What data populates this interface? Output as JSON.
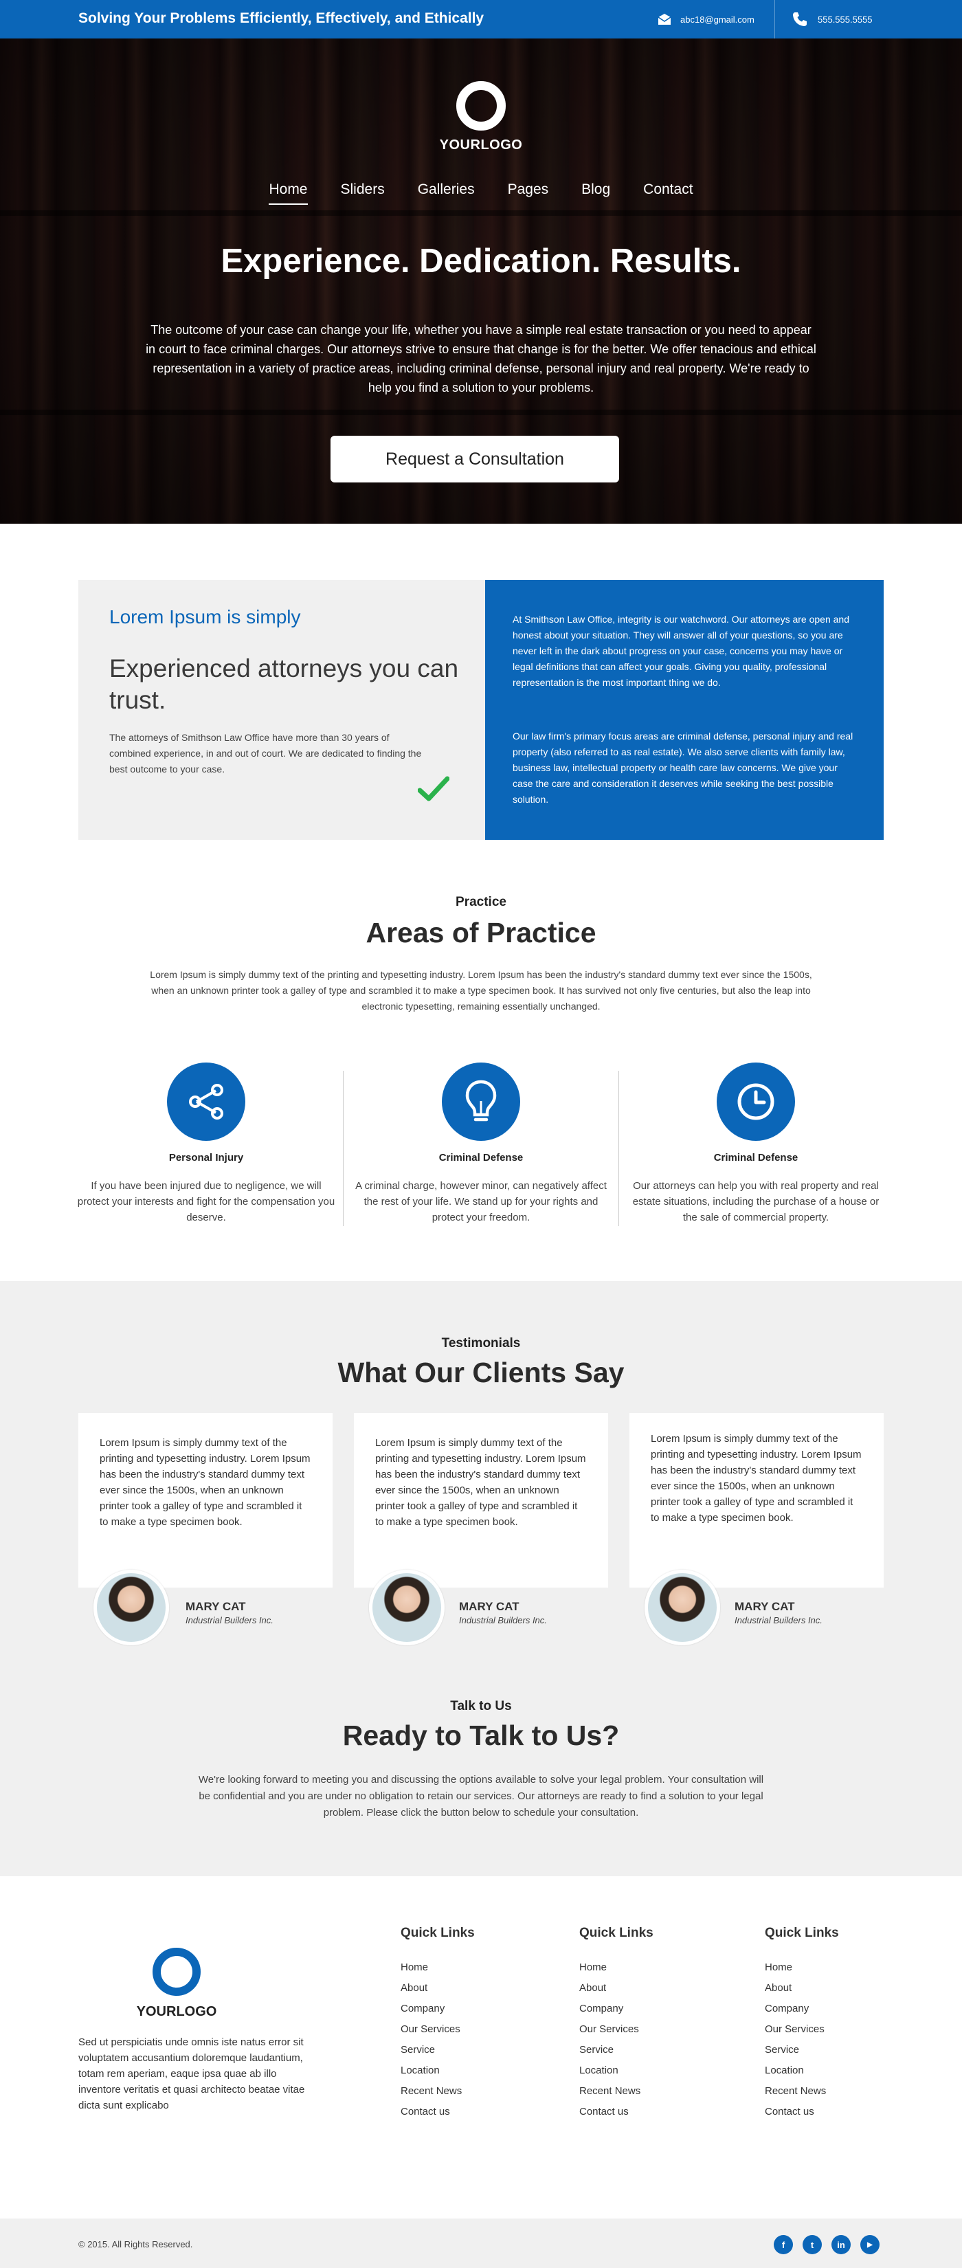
{
  "topbar": {
    "tagline": "Solving Your Problems Efficiently, Effectively, and Ethically",
    "email": "abc18@gmail.com",
    "phone": "555.555.5555",
    "email_icon": "envelope-icon",
    "phone_icon": "phone-icon"
  },
  "hero": {
    "logo_text": "YOURLOGO",
    "nav": [
      "Home",
      "Sliders",
      "Galleries",
      "Pages",
      "Blog",
      "Contact"
    ],
    "active_nav": "Home",
    "headline": "Experience. Dedication. Results.",
    "intro": "The outcome of your case can change your life, whether you have a simple real estate transaction or you need to appear in court to face criminal charges. Our attorneys strive to ensure that change is for the better. We offer tenacious and ethical representation in a variety of practice areas, including criminal defense, personal injury and real property. We're ready to help you find a solution to your problems.",
    "cta": "Request a Consultation"
  },
  "about": {
    "kicker": "Lorem Ipsum is simply",
    "heading": "Experienced attorneys you can trust.",
    "description": "The attorneys of Smithson Law Office have more than 30 years of combined experience, in and out of court. We are dedicated to finding the best outcome to your case.",
    "paragraph1": "At Smithson Law Office, integrity is our watchword. Our attorneys are open and honest about your situation. They will answer all of your questions, so you are never left in the dark about progress on your case, concerns you may have or legal definitions that can affect your goals. Giving you quality, professional representation is the most important thing we do.",
    "paragraph2": "Our law firm's primary focus areas are criminal defense, personal injury and real property (also referred to as real estate). We also serve clients with family law, business law, intellectual property or health care law concerns. We give your case the care and consideration it deserves while seeking the best possible solution."
  },
  "practice": {
    "kicker": "Practice",
    "title": "Areas of Practice",
    "intro": "Lorem Ipsum is simply dummy text of the printing and typesetting industry. Lorem Ipsum has been the industry's standard dummy text ever since the 1500s, when an unknown printer took a galley of type and scrambled it to make a type specimen book. It has survived not only five centuries, but also the leap into electronic typesetting, remaining essentially unchanged.",
    "items": [
      {
        "icon": "share-icon",
        "title": "Personal Injury",
        "text": "If you have been injured due to negligence, we will protect your interests and fight for the compensation you deserve."
      },
      {
        "icon": "lightbulb-icon",
        "title": "Criminal Defense",
        "text": "A criminal charge, however minor, can negatively affect the rest of your life. We stand up for your rights and protect your freedom."
      },
      {
        "icon": "clock-icon",
        "title": "Criminal Defense",
        "text": "Our attorneys can help you with real property and real estate situations, including the purchase of a house or the sale of commercial property."
      }
    ]
  },
  "testimonials": {
    "kicker": "Testimonials",
    "title": "What Our Clients Say",
    "items": [
      {
        "quote": "Lorem Ipsum is simply dummy text of the printing and typesetting industry. Lorem Ipsum has been the industry's standard dummy text ever since the 1500s, when an unknown printer took a galley of type and scrambled it to make a type specimen book.",
        "name": "MARY CAT",
        "company": "Industrial Builders Inc."
      },
      {
        "quote": "Lorem Ipsum is simply dummy text of the printing and typesetting industry. Lorem Ipsum has been the industry's standard dummy text ever since the 1500s, when an unknown printer took a galley of type and scrambled it to make a type specimen book.",
        "name": "MARY CAT",
        "company": "Industrial Builders Inc."
      },
      {
        "quote": "Lorem Ipsum is simply dummy text of the printing and typesetting industry. Lorem Ipsum has been the industry's standard dummy text ever since the 1500s, when an unknown printer took a galley of type and scrambled it to make a type specimen book.",
        "name": "MARY CAT",
        "company": "Industrial Builders Inc."
      }
    ]
  },
  "talk": {
    "kicker": "Talk to Us",
    "title": "Ready to Talk to Us?",
    "text": "We're looking forward to meeting you and discussing the options available to solve your legal problem. Your consultation will be confidential and you are under no obligation to retain our services. Our attorneys are ready to find a solution to your legal problem. Please click the button below to schedule your consultation."
  },
  "footer": {
    "logo_text": "YOURLOGO",
    "about": "Sed ut perspiciatis unde omnis iste natus error sit voluptatem accusantium doloremque laudantium, totam rem aperiam, eaque ipsa quae ab illo inventore veritatis et quasi architecto beatae vitae dicta sunt explicabo",
    "columns": [
      {
        "title": "Quick Links",
        "links": [
          "Home",
          "About",
          "Company",
          "Our Services",
          "Service",
          "Location",
          "Recent News",
          "Contact us"
        ]
      },
      {
        "title": "Quick Links",
        "links": [
          "Home",
          "About",
          "Company",
          "Our Services",
          "Service",
          "Location",
          "Recent News",
          "Contact us"
        ]
      },
      {
        "title": "Quick Links",
        "links": [
          "Home",
          "About",
          "Company",
          "Our Services",
          "Service",
          "Location",
          "Recent News",
          "Contact us"
        ]
      }
    ],
    "copyright": "© 2015. All Rights Reserved.",
    "social": [
      {
        "icon": "facebook-icon",
        "glyph": "f"
      },
      {
        "icon": "twitter-icon",
        "glyph": "t"
      },
      {
        "icon": "linkedin-icon",
        "glyph": "in"
      },
      {
        "icon": "youtube-icon",
        "glyph": "▶"
      }
    ]
  },
  "colors": {
    "brand_blue": "#0b66b8",
    "check_green": "#2bb24c",
    "light_gray": "#f0f0f0"
  }
}
